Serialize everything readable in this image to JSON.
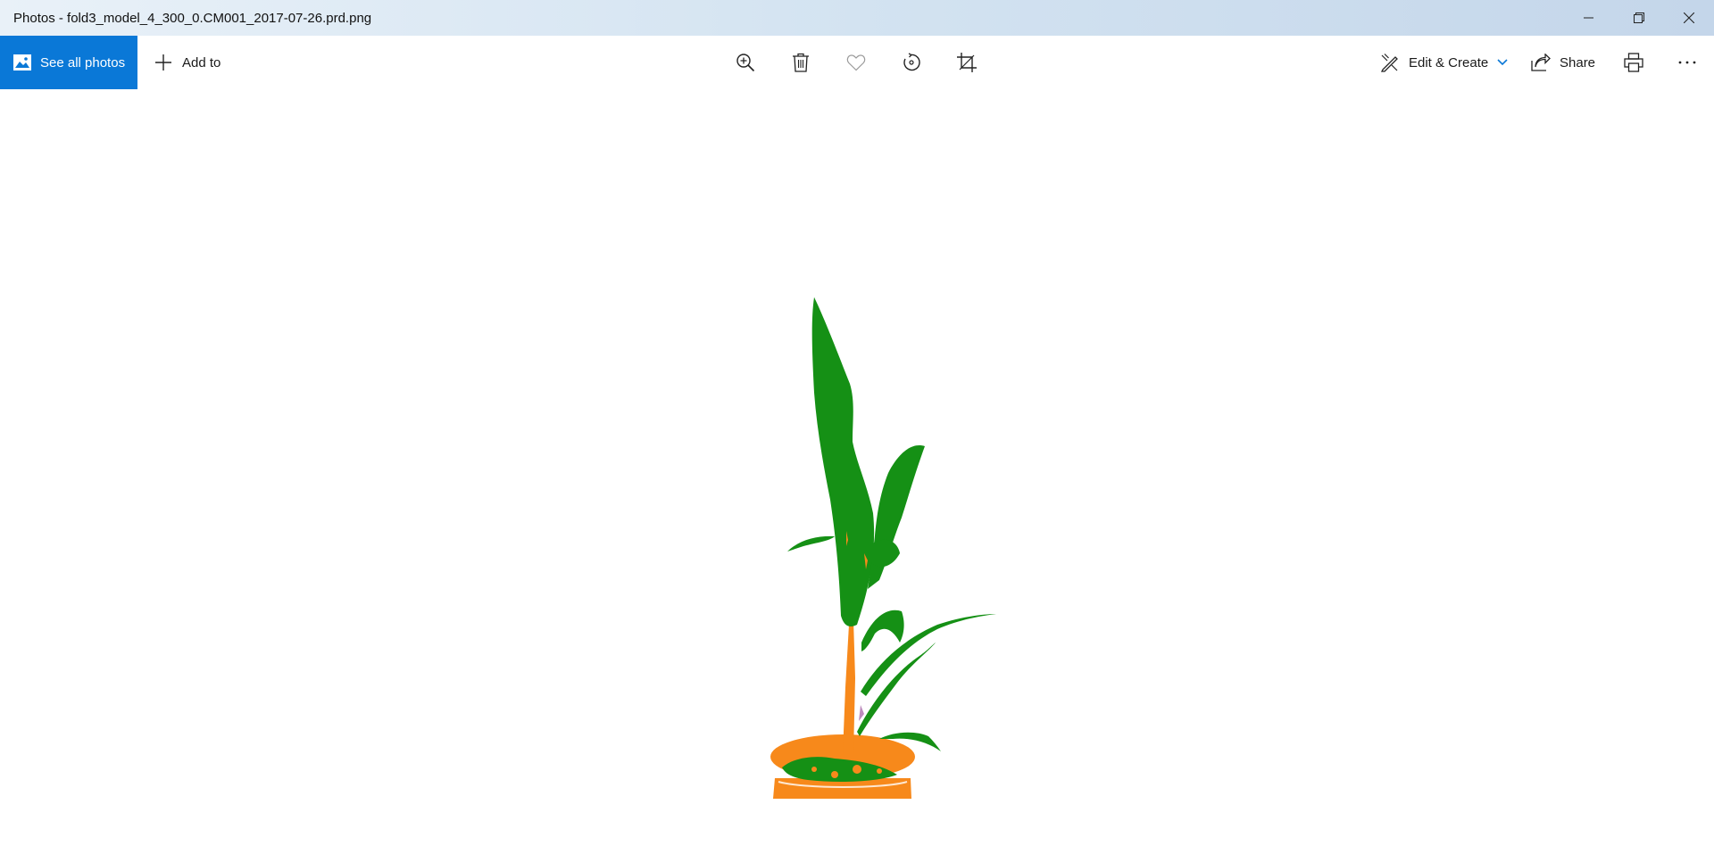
{
  "window": {
    "title": "Photos - fold3_model_4_300_0.CM001_2017-07-26.prd.png",
    "controls": [
      "minimize-icon",
      "restore-icon",
      "close-icon"
    ]
  },
  "toolbar": {
    "see_all_label": "See all photos",
    "add_to_label": "Add to",
    "center_icons": [
      "zoom-in-icon",
      "delete-icon",
      "favorite-icon",
      "rotate-icon",
      "crop-icon"
    ],
    "edit_create_label": "Edit & Create",
    "share_label": "Share",
    "right_icons": [
      "print-icon",
      "more-icon"
    ]
  },
  "colors": {
    "accent": "#0a78d7",
    "leaf": "#159015",
    "pot": "#f7891b"
  },
  "image": {
    "subject_colors": [
      "green",
      "orange"
    ]
  }
}
